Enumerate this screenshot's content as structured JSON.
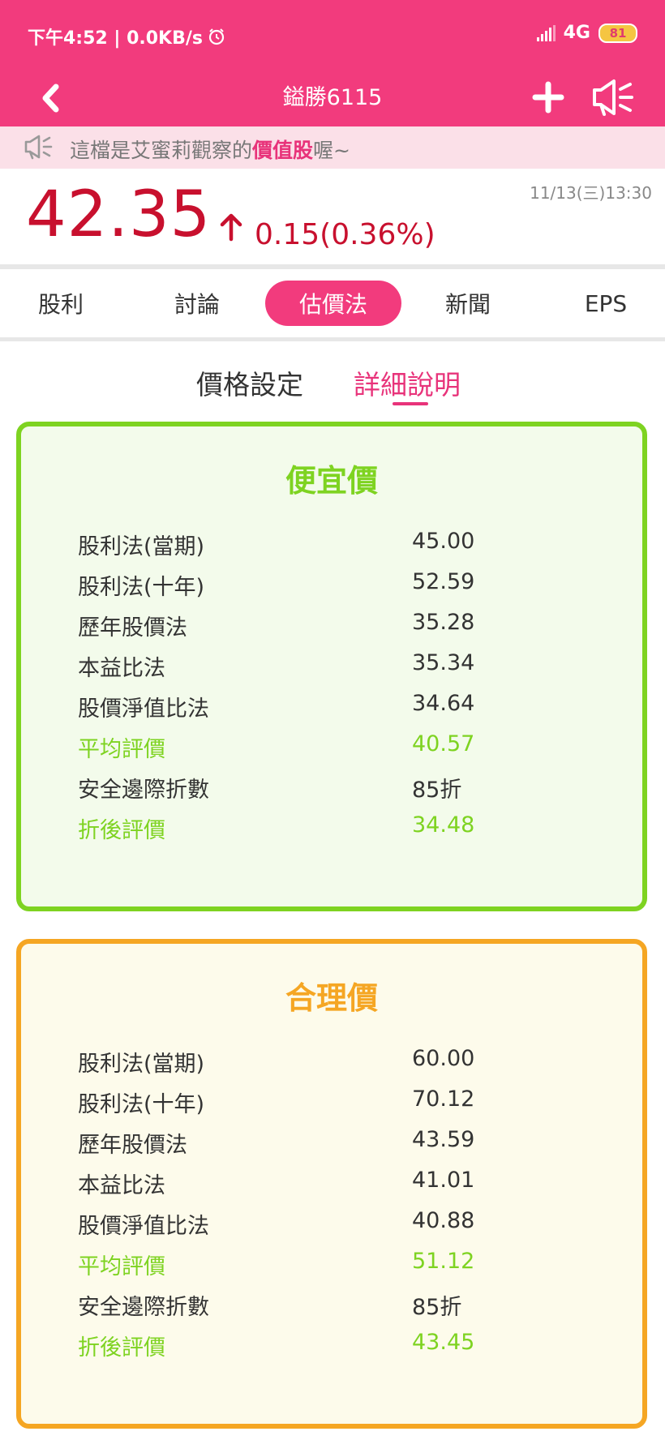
{
  "status_bar": {
    "time_speed": "下午4:52 | 0.0KB/s",
    "network": "4G",
    "battery": "81"
  },
  "header": {
    "title": "鎰勝6115"
  },
  "notice": {
    "prefix": "這檔是艾蜜莉觀察的",
    "highlight": "價值股",
    "suffix": "喔~"
  },
  "quote": {
    "time": "11/13(三)13:30",
    "price": "42.35",
    "change": "0.15(0.36%)"
  },
  "tabs": [
    {
      "label": "股利",
      "active": false
    },
    {
      "label": "討論",
      "active": false
    },
    {
      "label": "估價法",
      "active": true
    },
    {
      "label": "新聞",
      "active": false
    },
    {
      "label": "EPS",
      "active": false
    }
  ],
  "subtabs": [
    {
      "label": "價格設定",
      "active": false
    },
    {
      "label": "詳細說明",
      "active": true
    }
  ],
  "cards": [
    {
      "title": "便宜價",
      "rows": [
        {
          "label": "股利法(當期)",
          "value": "45.00"
        },
        {
          "label": "股利法(十年)",
          "value": "52.59"
        },
        {
          "label": "歷年股價法",
          "value": "35.28"
        },
        {
          "label": "本益比法",
          "value": "35.34"
        },
        {
          "label": "股價淨值比法",
          "value": "34.64"
        },
        {
          "label": "平均評價",
          "value": "40.57"
        },
        {
          "label": "安全邊際折數",
          "value": "85折"
        },
        {
          "label": "折後評價",
          "value": "34.48"
        }
      ]
    },
    {
      "title": "合理價",
      "rows": [
        {
          "label": "股利法(當期)",
          "value": "60.00"
        },
        {
          "label": "股利法(十年)",
          "value": "70.12"
        },
        {
          "label": "歷年股價法",
          "value": "43.59"
        },
        {
          "label": "本益比法",
          "value": "41.01"
        },
        {
          "label": "股價淨值比法",
          "value": "40.88"
        },
        {
          "label": "平均評價",
          "value": "51.12"
        },
        {
          "label": "安全邊際折數",
          "value": "85折"
        },
        {
          "label": "折後評價",
          "value": "43.45"
        }
      ]
    }
  ],
  "colors": {
    "brand": "#f23b7d",
    "price_up": "#c8102e",
    "cheap_card": "#7ed321",
    "fair_card": "#f5a623"
  }
}
